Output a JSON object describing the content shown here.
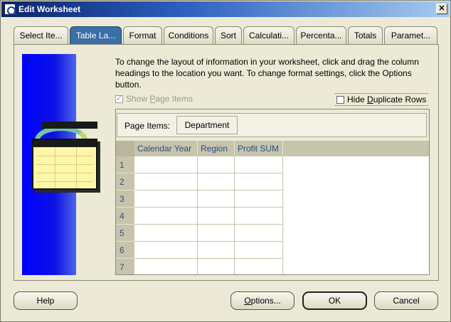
{
  "window": {
    "title": "Edit Worksheet",
    "close_glyph": "✕"
  },
  "tabs": [
    {
      "label": "Select Ite...",
      "active": false
    },
    {
      "label": "Table La...",
      "active": true
    },
    {
      "label": "Format",
      "active": false
    },
    {
      "label": "Conditions",
      "active": false
    },
    {
      "label": "Sort",
      "active": false
    },
    {
      "label": "Calculati...",
      "active": false
    },
    {
      "label": "Percenta...",
      "active": false
    },
    {
      "label": "Totals",
      "active": false
    },
    {
      "label": "Paramet...",
      "active": false
    }
  ],
  "instructions": "To change the layout of information in your worksheet, click and drag the column headings to the location you want.  To change format settings, click the Options button.",
  "show_page_items": {
    "label_pre": "Show ",
    "label_u": "P",
    "label_post": "age Items",
    "checked": true,
    "enabled": false
  },
  "hide_duplicate_rows": {
    "label_pre": "Hide ",
    "label_u": "D",
    "label_post": "uplicate Rows",
    "checked": false
  },
  "page_items": {
    "label": "Page Items:",
    "items": [
      "Department"
    ]
  },
  "table": {
    "columns": [
      "Calendar Year",
      "Region",
      "Profit SUM"
    ],
    "rows": [
      "1",
      "2",
      "3",
      "4",
      "5",
      "6",
      "7"
    ]
  },
  "buttons": {
    "help": "Help",
    "options_pre": "",
    "options_u": "O",
    "options_post": "ptions...",
    "ok": "OK",
    "cancel": "Cancel"
  },
  "colors": {
    "active_tab": "#3a6fa8",
    "art_blue": "#0000ff",
    "header_text": "#2a4f86"
  }
}
